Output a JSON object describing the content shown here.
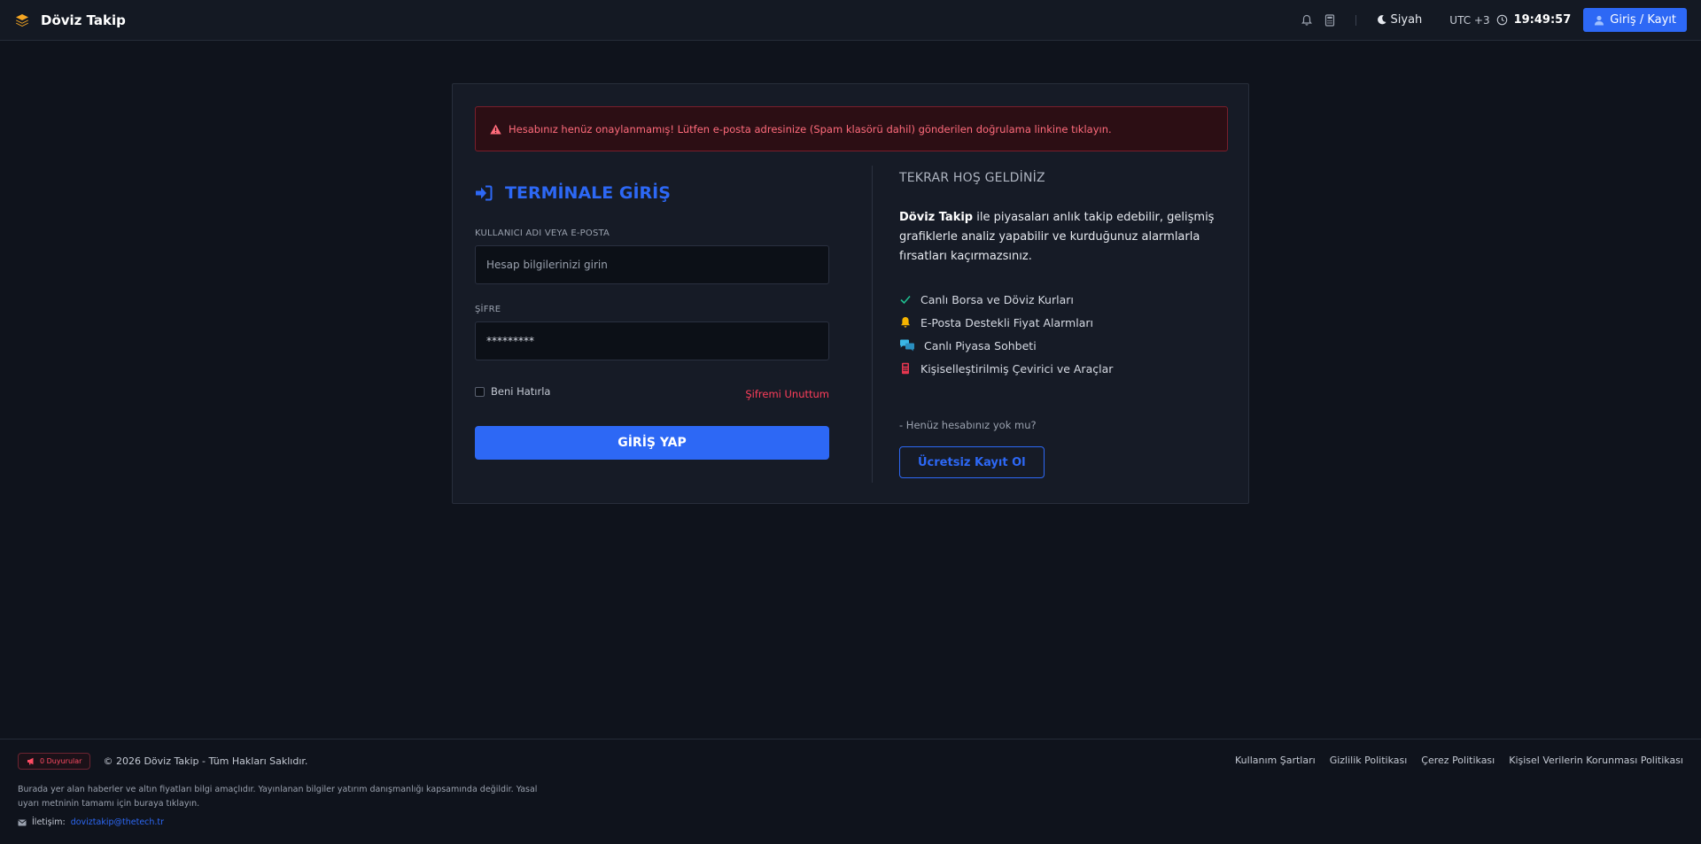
{
  "navbar": {
    "brand_name": "Döviz Takip",
    "icons": [
      "stack-logo-icon",
      "bell-icon",
      "calculator-icon",
      "moon-icon",
      "clock-icon",
      "user-icon"
    ],
    "theme_label": "Siyah",
    "timezone_label": "UTC +3",
    "time": "19:49:57",
    "login_label": "Giriş / Kayıt"
  },
  "alert": {
    "message": "Hesabınız henüz onaylanmamış! Lütfen e-posta adresinize (Spam klasörü dahil) gönderilen doğrulama linkine tıklayın."
  },
  "login": {
    "title": "TERMİNALE GİRİŞ",
    "username_label": "KULLANICI ADI VEYA E-POSTA",
    "username_placeholder": "Hesap bilgilerinizi girin",
    "password_label": "ŞİFRE",
    "password_value": "*********",
    "remember_label": "Beni Hatırla",
    "forgot_label": "Şifremi Unuttum",
    "submit_label": "GİRİŞ YAP"
  },
  "welcome": {
    "title": "TEKRAR HOŞ GELDİNİZ",
    "brand": "Döviz Takip",
    "text": " ile piyasaları anlık takip edebilir, gelişmiş grafiklerle analiz yapabilir ve kurduğunuz alarmlarla fırsatları kaçırmazsınız.",
    "features": [
      {
        "label": "Canlı Borsa ve Döviz Kurları",
        "icon": "check-icon"
      },
      {
        "label": "E-Posta Destekli Fiyat Alarmları",
        "icon": "bell-icon"
      },
      {
        "label": "Canlı Piyasa Sohbeti",
        "icon": "chat-icon"
      },
      {
        "label": "Kişiselleştirilmiş Çevirici ve Araçlar",
        "icon": "calculator-icon"
      }
    ],
    "no_account": "- Henüz hesabınız yok mu?",
    "register_label": "Ücretsiz Kayıt Ol"
  },
  "footer": {
    "announcements_label": "0 Duyurular",
    "copyright": "© 2026 Döviz Takip - Tüm Hakları Saklıdır.",
    "links": [
      "Kullanım Şartları",
      "Gizlilik Politikası",
      "Çerez Politikası",
      "Kişisel Verilerin Korunması Politikası"
    ],
    "disclaimer": "Burada yer alan haberler ve altın fiyatları bilgi amaçlıdır. Yayınlanan bilgiler yatırım danışmanlığı kapsamında değildir. Yasal uyarı metninin tamamı için buraya tıklayın.",
    "contact_label": "İletişim:",
    "contact_email": "doviztakip@thetech.tr"
  },
  "colors": {
    "accent": "#2d68f5",
    "danger": "#ff3e5b",
    "background": "#0f131c",
    "card": "#161b26"
  }
}
